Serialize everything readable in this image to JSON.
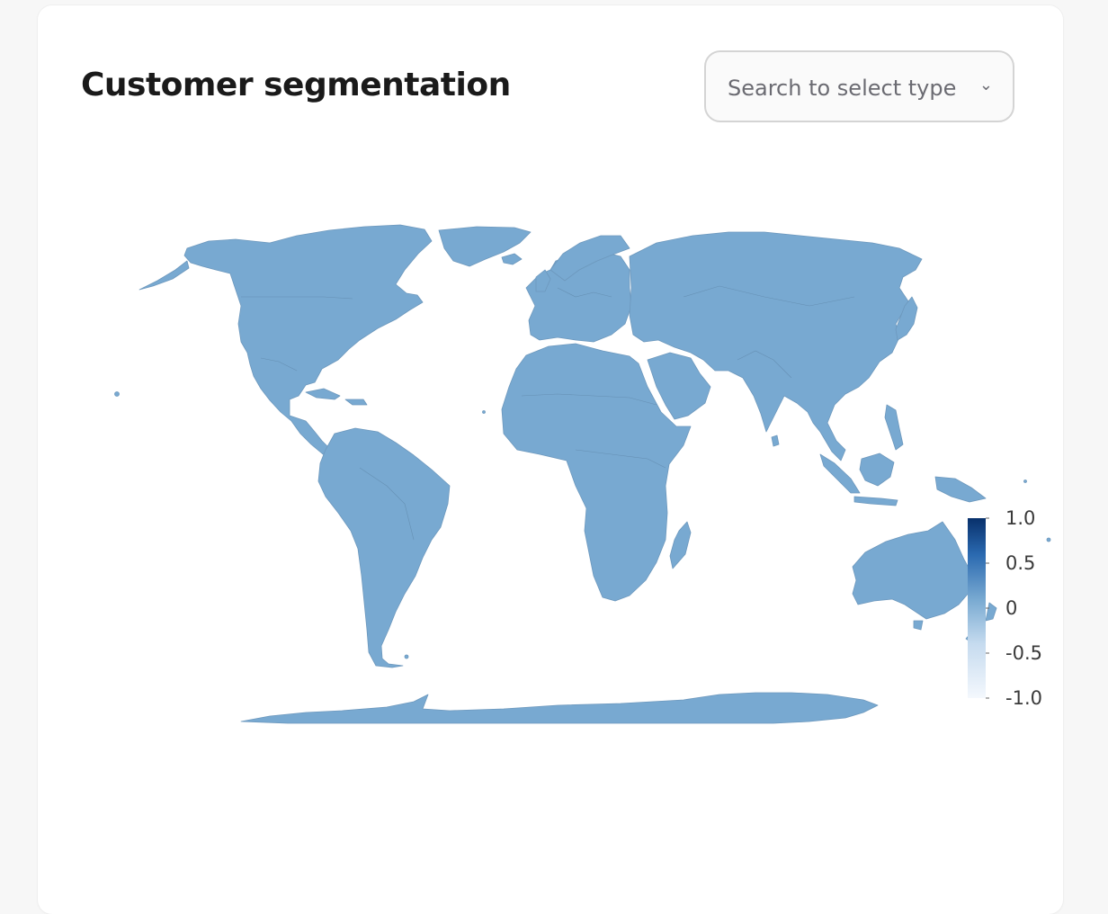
{
  "header": {
    "title": "Customer segmentation"
  },
  "type_select": {
    "placeholder": "Search to select type",
    "icon": "chevron-down-icon"
  },
  "map": {
    "projection": "equirectangular",
    "fill_color": "#78a9d1",
    "colorscale": [
      "#f4f8fd",
      "#c6dbef",
      "#78a9d1",
      "#2a69b0",
      "#08306b"
    ],
    "colorbar": {
      "range": [
        -1.0,
        1.0
      ],
      "ticks": [
        "1.0",
        "0.5",
        "0",
        "-0.5",
        "-1.0"
      ]
    },
    "region_value": 0
  }
}
